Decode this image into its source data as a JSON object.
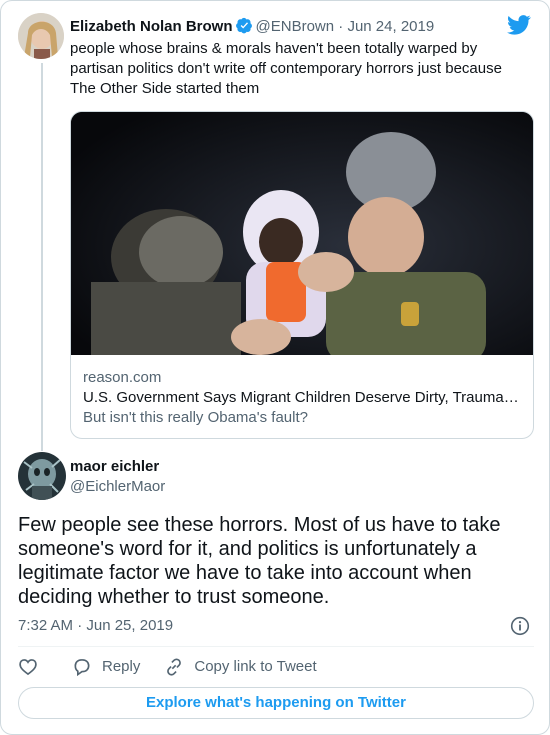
{
  "colors": {
    "accent": "#1d9bf0",
    "muted": "#536471",
    "text": "#0f1419",
    "border": "#cfd9de"
  },
  "quoted_tweet": {
    "author_name": "Elizabeth Nolan Brown",
    "verified": true,
    "handle": "@ENBrown",
    "separator": "·",
    "date": "Jun 24, 2019",
    "text": "people whose brains & morals haven't been totally warped by partisan politics don't write off contemporary horrors just because The Other Side started them",
    "link_card": {
      "domain": "reason.com",
      "title": "U.S. Government Says Migrant Children Deserve Dirty, Trauma…",
      "description": "But isn't this really Obama's fault?"
    }
  },
  "reply_tweet": {
    "author_name": "maor eichler",
    "handle": "@EichlerMaor",
    "text": "Few people see these horrors. Most of us have to take someone's word for it, and politics is unfortunately a legitimate factor we have to take into account when deciding whether to trust someone.",
    "timestamp": "7:32 AM · Jun 25, 2019"
  },
  "actions": {
    "like_icon": "heart-icon",
    "reply_label": "Reply",
    "copy_link_label": "Copy link to Tweet"
  },
  "explore_button": "Explore what's happening on Twitter"
}
